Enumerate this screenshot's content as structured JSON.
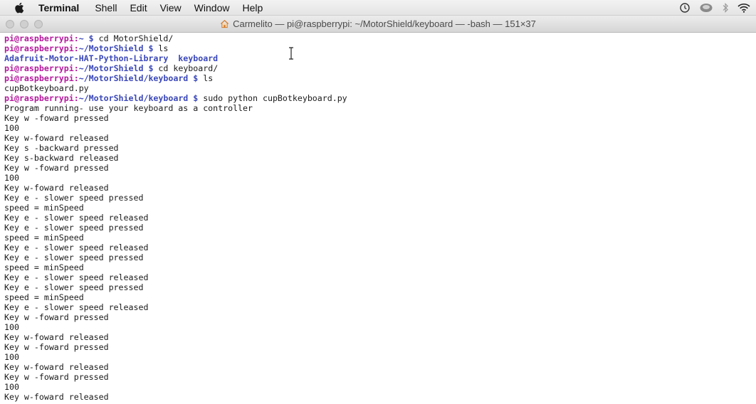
{
  "menubar": {
    "app_name": "Terminal",
    "items": [
      "Shell",
      "Edit",
      "View",
      "Window",
      "Help"
    ]
  },
  "window": {
    "title": "Carmelito — pi@raspberrypi: ~/MotorShield/keyboard — -bash — 151×37"
  },
  "terminal": {
    "lines": [
      {
        "kind": "prompt",
        "user": "pi@raspberrypi",
        "path": "~",
        "cmd": "cd MotorShield/"
      },
      {
        "kind": "prompt",
        "user": "pi@raspberrypi",
        "path": "~/MotorShield",
        "cmd": "ls"
      },
      {
        "kind": "dirs",
        "text": "Adafruit-Motor-HAT-Python-Library  keyboard"
      },
      {
        "kind": "prompt",
        "user": "pi@raspberrypi",
        "path": "~/MotorShield",
        "cmd": "cd keyboard/"
      },
      {
        "kind": "prompt",
        "user": "pi@raspberrypi",
        "path": "~/MotorShield/keyboard",
        "cmd": "ls"
      },
      {
        "kind": "text",
        "text": "cupBotkeyboard.py"
      },
      {
        "kind": "prompt",
        "user": "pi@raspberrypi",
        "path": "~/MotorShield/keyboard",
        "cmd": "sudo python cupBotkeyboard.py"
      },
      {
        "kind": "text",
        "text": "Program running- use your keyboard as a controller"
      },
      {
        "kind": "text",
        "text": "Key w -foward pressed"
      },
      {
        "kind": "text",
        "text": "100"
      },
      {
        "kind": "text",
        "text": "Key w-foward released"
      },
      {
        "kind": "text",
        "text": "Key s -backward pressed"
      },
      {
        "kind": "text",
        "text": "Key s-backward released"
      },
      {
        "kind": "text",
        "text": "Key w -foward pressed"
      },
      {
        "kind": "text",
        "text": "100"
      },
      {
        "kind": "text",
        "text": "Key w-foward released"
      },
      {
        "kind": "text",
        "text": "Key e - slower speed pressed"
      },
      {
        "kind": "text",
        "text": "speed = minSpeed"
      },
      {
        "kind": "text",
        "text": "Key e - slower speed released"
      },
      {
        "kind": "text",
        "text": "Key e - slower speed pressed"
      },
      {
        "kind": "text",
        "text": "speed = minSpeed"
      },
      {
        "kind": "text",
        "text": "Key e - slower speed released"
      },
      {
        "kind": "text",
        "text": "Key e - slower speed pressed"
      },
      {
        "kind": "text",
        "text": "speed = minSpeed"
      },
      {
        "kind": "text",
        "text": "Key e - slower speed released"
      },
      {
        "kind": "text",
        "text": "Key e - slower speed pressed"
      },
      {
        "kind": "text",
        "text": "speed = minSpeed"
      },
      {
        "kind": "text",
        "text": "Key e - slower speed released"
      },
      {
        "kind": "text",
        "text": "Key w -foward pressed"
      },
      {
        "kind": "text",
        "text": "100"
      },
      {
        "kind": "text",
        "text": "Key w-foward released"
      },
      {
        "kind": "text",
        "text": "Key w -foward pressed"
      },
      {
        "kind": "text",
        "text": "100"
      },
      {
        "kind": "text",
        "text": "Key w-foward released"
      },
      {
        "kind": "text",
        "text": "Key w -foward pressed"
      },
      {
        "kind": "text",
        "text": "100"
      },
      {
        "kind": "text",
        "text": "Key w-foward released"
      }
    ]
  }
}
